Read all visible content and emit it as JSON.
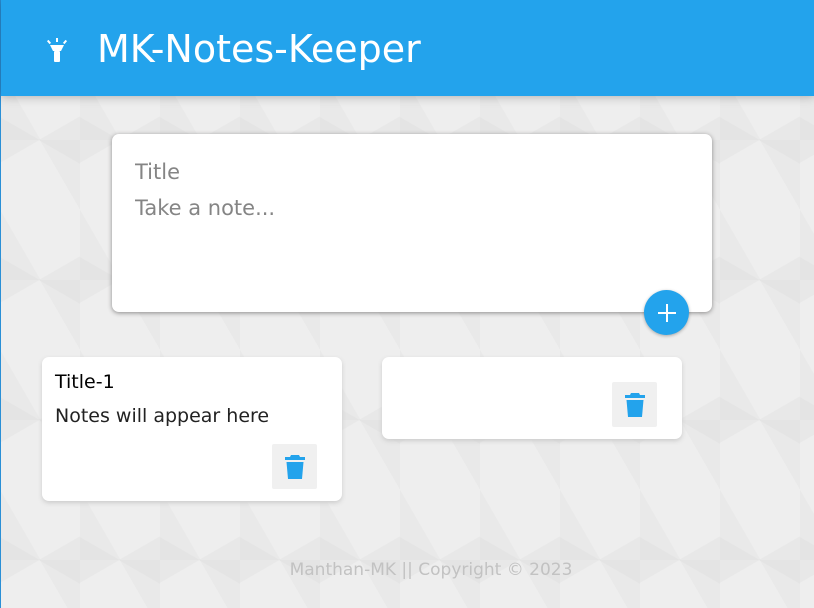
{
  "header": {
    "app_title": "MK-Notes-Keeper",
    "logo_icon": "flashlight-icon",
    "color": "#23a3ec"
  },
  "create_note": {
    "title_placeholder": "Title",
    "content_placeholder": "Take a note...",
    "title_value": "",
    "content_value": "",
    "add_icon": "plus-icon"
  },
  "notes": [
    {
      "title": "Title-1",
      "content": "Notes will appear here",
      "delete_icon": "trash-icon"
    },
    {
      "title": "",
      "content": "",
      "delete_icon": "trash-icon"
    }
  ],
  "footer": {
    "text": "Manthan-MK || Copyright © 2023"
  }
}
